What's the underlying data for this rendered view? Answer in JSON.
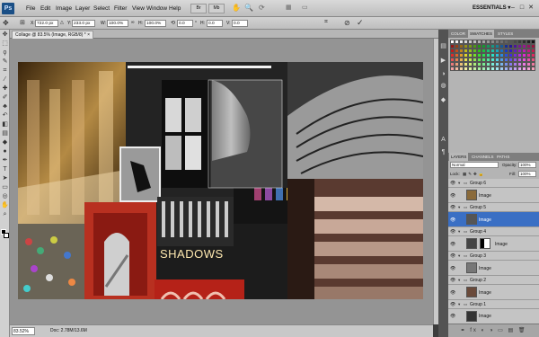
{
  "app": {
    "logo": "Ps"
  },
  "menu": [
    "File",
    "Edit",
    "Image",
    "Layer",
    "Select",
    "Filter",
    "View",
    "Window",
    "Help"
  ],
  "menu_mini": [
    "Br",
    "Mb"
  ],
  "workspace": "ESSENTIALS ▾",
  "window_buttons": [
    "–",
    "□",
    "✕"
  ],
  "options": {
    "x_value": "722.0 px",
    "y_value": "233.0 px",
    "w_value": "100.0%",
    "h_value": "100.0%",
    "angle": "0.0",
    "hskew": "0.0",
    "vskew": "0.0"
  },
  "document": {
    "tab_title": "Collage @ 83.5% (Image, RGB/8) * ×"
  },
  "status": {
    "zoom": "83.52%",
    "doc_size": "Doc: 2.78M/13.6M"
  },
  "canvas_text": "SHADOWS",
  "panel_tabs_top": [
    "COLOR",
    "SWATCHES",
    "STYLES"
  ],
  "panel_tabs_layers": [
    "LAYERS",
    "CHANNELS",
    "PATHS"
  ],
  "layer_controls": {
    "blend_mode": "Normal",
    "opacity_label": "Opacity:",
    "opacity": "100%",
    "lock_label": "Lock:",
    "fill_label": "Fill:",
    "fill": "100%"
  },
  "layers": [
    {
      "name": "Group 6",
      "type": "group"
    },
    {
      "name": "Image",
      "type": "image"
    },
    {
      "name": "Group 5",
      "type": "group"
    },
    {
      "name": "Image",
      "type": "image",
      "selected": true
    },
    {
      "name": "Group 4",
      "type": "group"
    },
    {
      "name": "Image",
      "type": "image-mask"
    },
    {
      "name": "Group 3",
      "type": "group"
    },
    {
      "name": "Image",
      "type": "image"
    },
    {
      "name": "Group 2",
      "type": "group"
    },
    {
      "name": "Image",
      "type": "image"
    },
    {
      "name": "Group 1",
      "type": "group"
    },
    {
      "name": "Image",
      "type": "image"
    }
  ],
  "layer_footer": "⚭ fx ◐ ◑ ▭ ▤ 🗑",
  "colors": {
    "selection": "#3a6fc4",
    "accent": "#1a4f86"
  }
}
